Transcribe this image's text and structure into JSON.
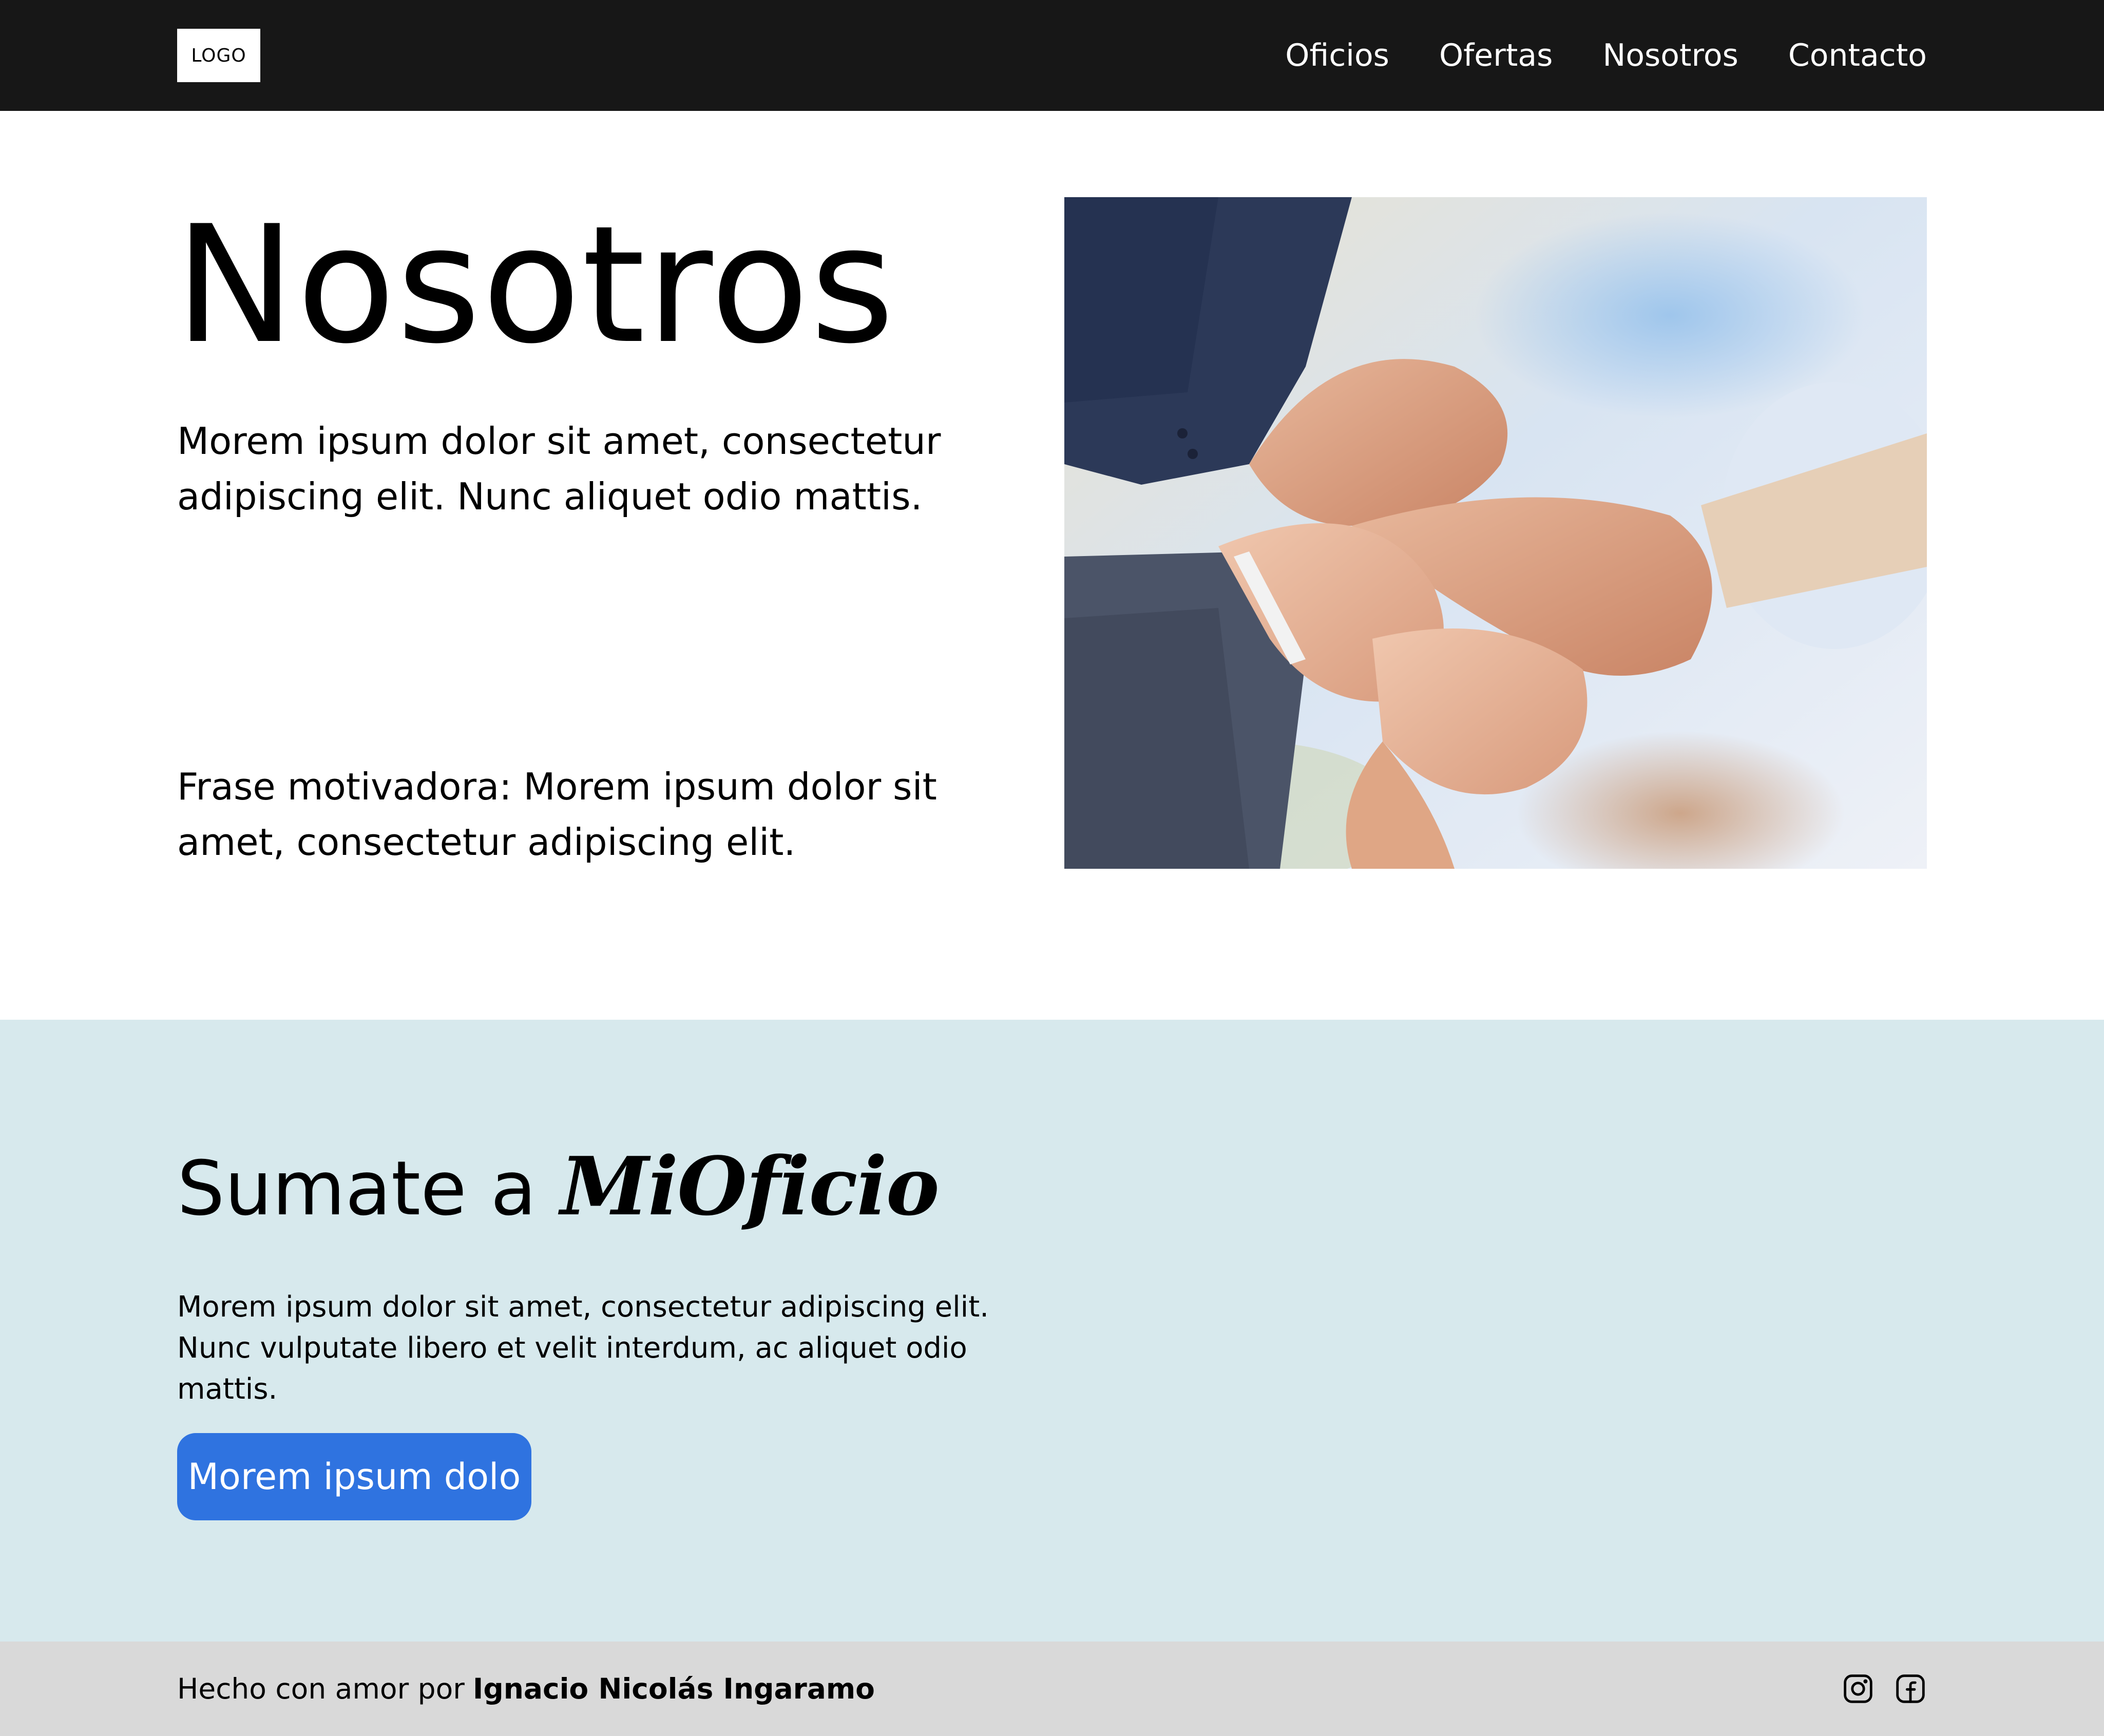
{
  "header": {
    "logo": "LOGO",
    "nav": [
      {
        "label": "Oficios"
      },
      {
        "label": "Ofertas"
      },
      {
        "label": "Nosotros"
      },
      {
        "label": "Contacto"
      }
    ]
  },
  "about": {
    "title": "Nosotros",
    "text": "Morem ipsum dolor sit amet, consectetur adipiscing elit. Nunc aliquet odio mattis.",
    "quote": "Frase motivadora: Morem ipsum dolor sit amet, consectetur adipiscing elit.",
    "image": "photo of four hands clasping each other's wrists"
  },
  "join": {
    "title_prefix": "Sumate a",
    "brand": "MiOficio",
    "text": "Morem ipsum dolor sit amet, consectetur adipiscing elit. Nunc vulputate libero et velit interdum, ac aliquet odio mattis.",
    "button": "Morem ipsum dolo"
  },
  "footer": {
    "credit_prefix": "Hecho con amor por",
    "author": "Ignacio Nicolás Ingaramo",
    "socials": [
      {
        "icon": "instagram-icon"
      },
      {
        "icon": "facebook-icon"
      }
    ]
  },
  "colors": {
    "nav_bg": "#171717",
    "join_bg": "#d7e9ed",
    "button_bg": "#2f73e0",
    "footer_bg": "#d9d9d9"
  }
}
